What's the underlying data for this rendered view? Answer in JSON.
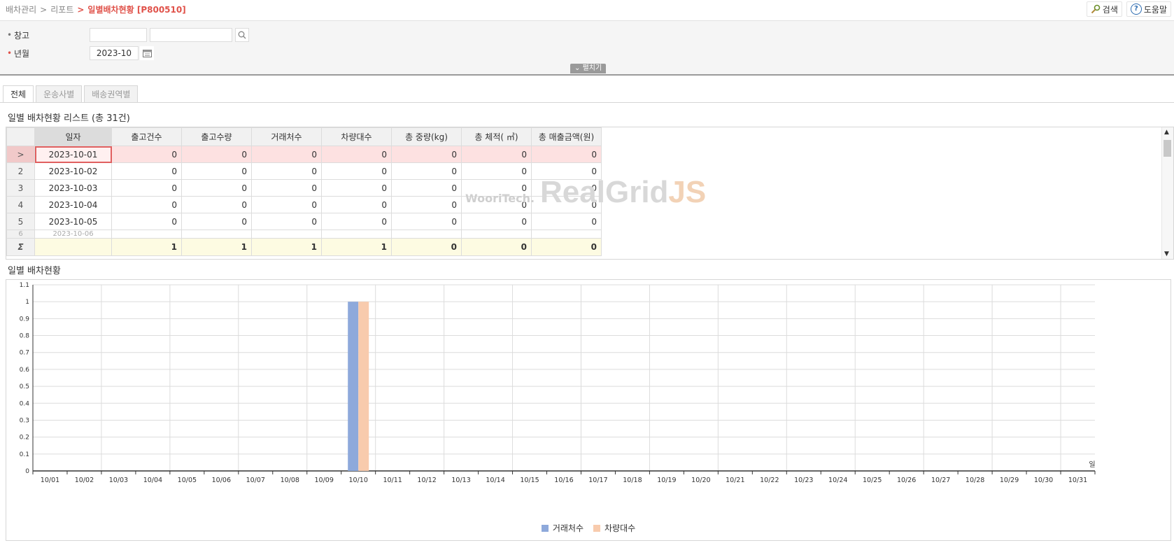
{
  "breadcrumb": {
    "items": [
      "배차관리",
      "리포트"
    ],
    "current": "일별배차현황 [P800510]"
  },
  "toolbar": {
    "search_label": "검색",
    "help_label": "도움말"
  },
  "search": {
    "warehouse_label": "창고",
    "warehouse_code": "",
    "warehouse_name": "",
    "yearmonth_label": "년월",
    "yearmonth_value": "2023-10",
    "expand_label": "펼치기"
  },
  "tabs": [
    {
      "label": "전체",
      "active": true
    },
    {
      "label": "운송사별",
      "active": false
    },
    {
      "label": "배송권역별",
      "active": false
    }
  ],
  "list": {
    "title": "일별 배차현황 리스트 (총 31건)",
    "columns": [
      "일자",
      "출고건수",
      "출고수량",
      "거래처수",
      "차량대수",
      "총 중량(kg)",
      "총 체적( ㎥)",
      "총 매출금액(원)"
    ],
    "rows": [
      {
        "indicator": ">",
        "date": "2023-10-01",
        "vals": [
          "0",
          "0",
          "0",
          "0",
          "0",
          "0",
          "0"
        ]
      },
      {
        "indicator": "2",
        "date": "2023-10-02",
        "vals": [
          "0",
          "0",
          "0",
          "0",
          "0",
          "0",
          "0"
        ]
      },
      {
        "indicator": "3",
        "date": "2023-10-03",
        "vals": [
          "0",
          "0",
          "0",
          "0",
          "0",
          "0",
          "0"
        ]
      },
      {
        "indicator": "4",
        "date": "2023-10-04",
        "vals": [
          "0",
          "0",
          "0",
          "0",
          "0",
          "0",
          "0"
        ]
      },
      {
        "indicator": "5",
        "date": "2023-10-05",
        "vals": [
          "0",
          "0",
          "0",
          "0",
          "0",
          "0",
          "0"
        ]
      }
    ],
    "cut_row": {
      "indicator": "6",
      "date": "2023-10-06"
    },
    "footer": {
      "indicator": "Σ",
      "vals": [
        "1",
        "1",
        "1",
        "1",
        "0",
        "0",
        "0"
      ]
    },
    "watermark_company": "WooriTech.",
    "watermark_brand": "RealGrid",
    "watermark_js": "JS"
  },
  "chart_title": "일별 배차현황",
  "chart_data": {
    "type": "bar",
    "categories": [
      "10/01",
      "10/02",
      "10/03",
      "10/04",
      "10/05",
      "10/06",
      "10/07",
      "10/08",
      "10/09",
      "10/10",
      "10/11",
      "10/12",
      "10/13",
      "10/14",
      "10/15",
      "10/16",
      "10/17",
      "10/18",
      "10/19",
      "10/20",
      "10/21",
      "10/22",
      "10/23",
      "10/24",
      "10/25",
      "10/26",
      "10/27",
      "10/28",
      "10/29",
      "10/30",
      "10/31"
    ],
    "series": [
      {
        "name": "거래처수",
        "color": "#8ea9db",
        "values": [
          0,
          0,
          0,
          0,
          0,
          0,
          0,
          0,
          0,
          1,
          0,
          0,
          0,
          0,
          0,
          0,
          0,
          0,
          0,
          0,
          0,
          0,
          0,
          0,
          0,
          0,
          0,
          0,
          0,
          0,
          0
        ]
      },
      {
        "name": "차량대수",
        "color": "#f8cbad",
        "values": [
          0,
          0,
          0,
          0,
          0,
          0,
          0,
          0,
          0,
          1,
          0,
          0,
          0,
          0,
          0,
          0,
          0,
          0,
          0,
          0,
          0,
          0,
          0,
          0,
          0,
          0,
          0,
          0,
          0,
          0,
          0
        ]
      }
    ],
    "xlabel": "일",
    "ylim": [
      0,
      1.1
    ],
    "yticks": [
      "0",
      "0.1",
      "0.2",
      "0.3",
      "0.4",
      "0.5",
      "0.6",
      "0.7",
      "0.8",
      "0.9",
      "1",
      "1.1"
    ],
    "grid": true,
    "legend": "bottom"
  }
}
